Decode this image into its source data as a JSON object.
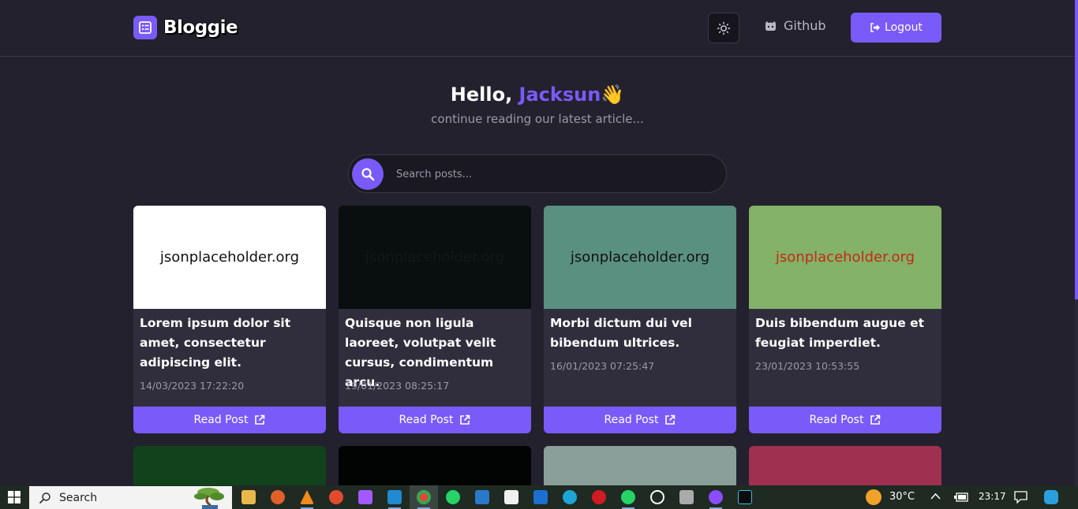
{
  "header": {
    "brand": "Bloggie",
    "github_label": "Github",
    "logout_label": "Logout"
  },
  "greeting": {
    "hello": "Hello, ",
    "name": "Jacksun",
    "emoji": "👋",
    "subtitle": "continue reading our latest article..."
  },
  "search": {
    "placeholder": "Search posts..."
  },
  "posts": [
    {
      "image_text": "jsonplaceholder.org",
      "image_bg": "#ffffff",
      "image_fg": "#111111",
      "title": "Lorem ipsum dolor sit amet, consectetur adipiscing elit.",
      "date": "14/03/2023 17:22:20",
      "button": "Read Post"
    },
    {
      "image_text": "jsonplaceholder.org",
      "image_bg": "#080f0e",
      "image_fg": "#0f1a18",
      "title": "Quisque non ligula laoreet, volutpat velit cursus, condimentum arcu.",
      "date": "19/01/2023 08:25:17",
      "button": "Read Post"
    },
    {
      "image_text": "jsonplaceholder.org",
      "image_bg": "#5a9080",
      "image_fg": "#111111",
      "title": "Morbi dictum dui vel bibendum ultrices.",
      "date": "16/01/2023 07:25:47",
      "button": "Read Post"
    },
    {
      "image_text": "jsonplaceholder.org",
      "image_bg": "#83b268",
      "image_fg": "#c62a15",
      "title": "Duis bibendum augue et feugiat imperdiet.",
      "date": "23/01/2023 10:53:55",
      "button": "Read Post"
    }
  ],
  "posts_row2_colors": [
    "#12421c",
    "#020403",
    "#8a9e9a",
    "#a03050"
  ],
  "taskbar": {
    "search_label": "Search",
    "weather": "30°C",
    "time": "23:17"
  }
}
